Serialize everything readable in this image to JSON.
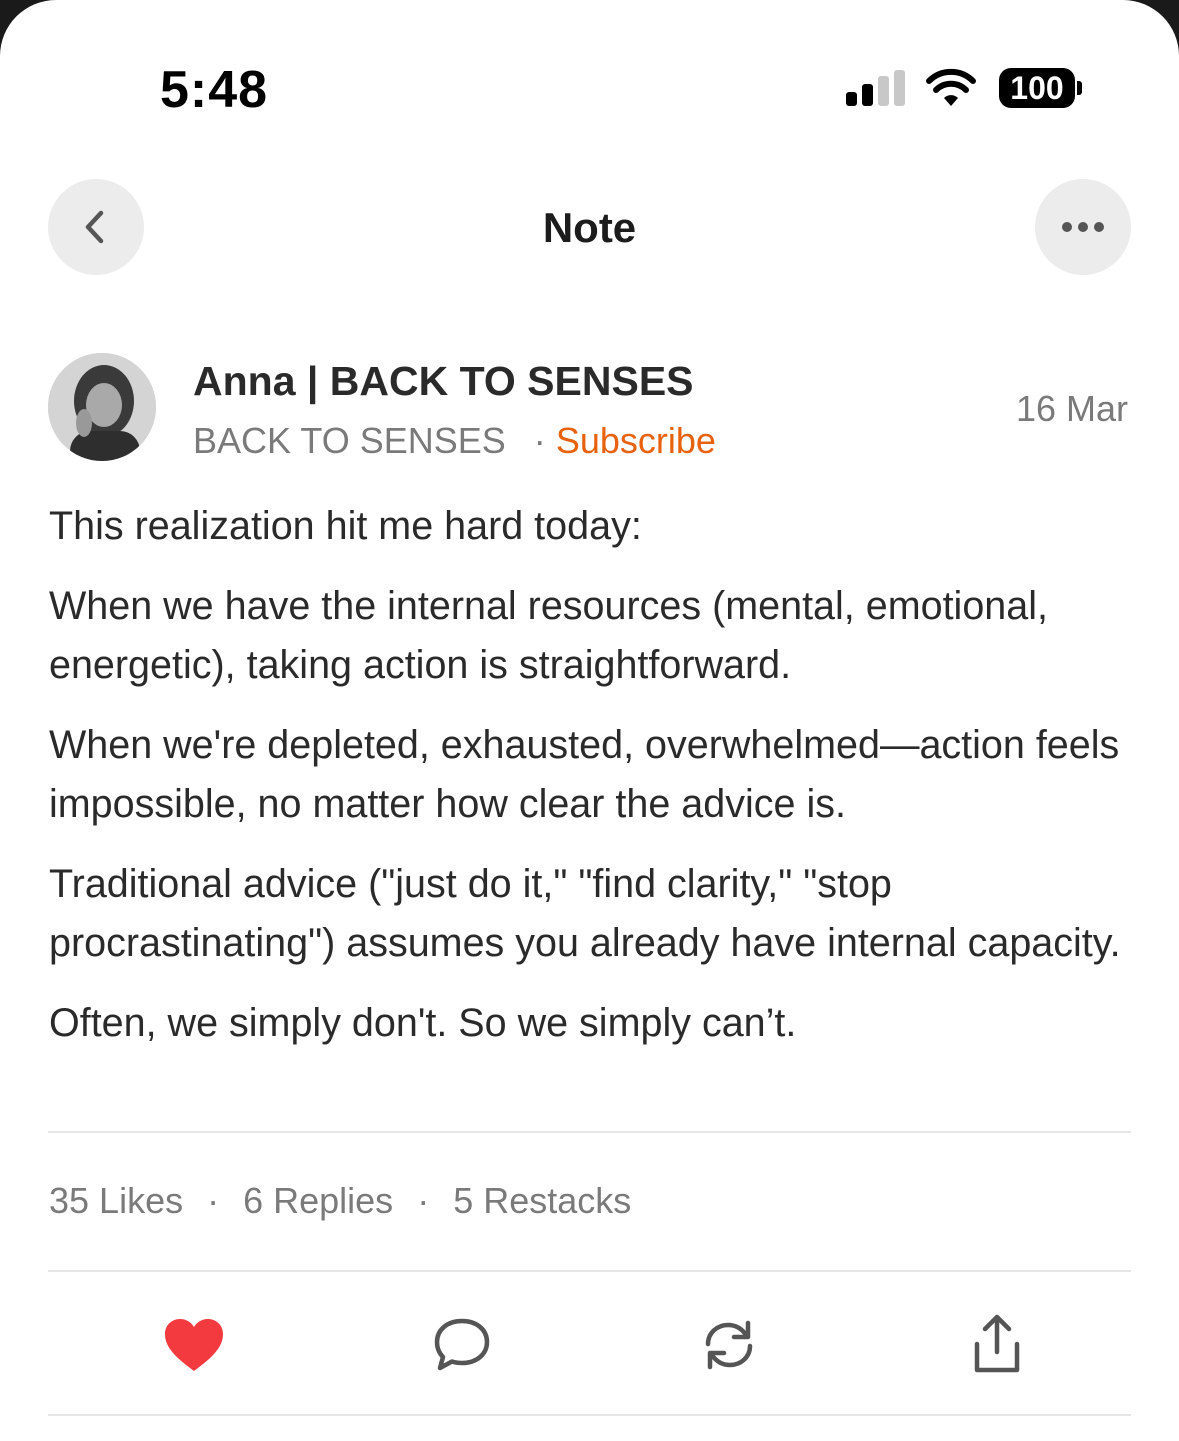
{
  "status_bar": {
    "time": "5:48",
    "battery": "100"
  },
  "header": {
    "title": "Note",
    "back_icon": "chevron-left-icon",
    "more_icon": "ellipsis-icon"
  },
  "author": {
    "name": "Anna | BACK TO SENSES",
    "publication": "BACK TO SENSES",
    "separator": "·",
    "subscribe_label": "Subscribe",
    "date": "16 Mar"
  },
  "note": {
    "paragraphs": [
      "This realization hit me hard today:",
      "When we have the internal resources (mental, emotional, energetic), taking action is straightforward.",
      "When we're depleted, exhausted, overwhelmed—action feels impossible, no matter how clear the advice is.",
      "Traditional advice (\"just do it,\" \"find clarity,\" \"stop procrastinating\") assumes you already have internal capacity.",
      "Often, we simply don't. So we simply can’t."
    ]
  },
  "stats": {
    "likes": "35 Likes",
    "replies": "6 Replies",
    "restacks": "5 Restacks",
    "separator": "·"
  },
  "actions": {
    "like_icon": "heart-icon",
    "reply_icon": "comment-icon",
    "restack_icon": "restack-icon",
    "share_icon": "share-icon"
  },
  "colors": {
    "accent": "#e8610e",
    "like": "#f23a3f",
    "text": "#2a2a2a",
    "muted": "#7a7a7a"
  }
}
